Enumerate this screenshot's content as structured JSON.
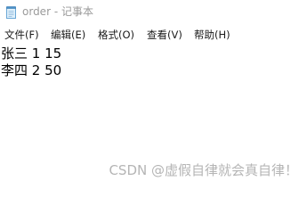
{
  "window": {
    "title": "order - 记事本"
  },
  "menubar": {
    "items": [
      {
        "label": "文件(F)"
      },
      {
        "label": "编辑(E)"
      },
      {
        "label": "格式(O)"
      },
      {
        "label": "查看(V)"
      },
      {
        "label": "帮助(H)"
      }
    ]
  },
  "editor": {
    "lines": [
      "张三 1 15",
      "李四 2 50"
    ]
  },
  "watermark": {
    "text": "CSDN @虚假自律就会真自律！"
  },
  "icons": {
    "app": "notepad-icon"
  }
}
